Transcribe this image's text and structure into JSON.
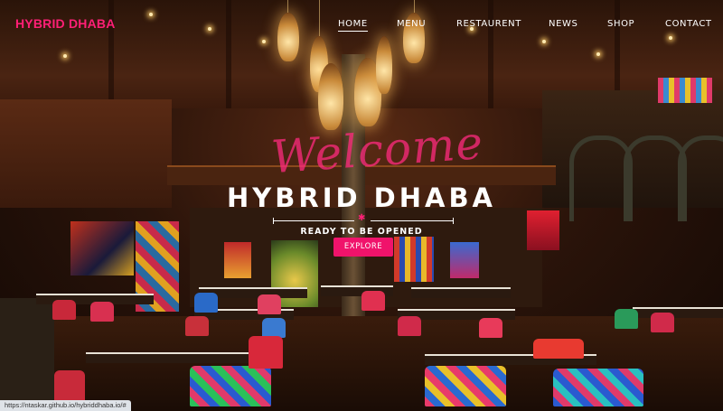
{
  "brand": "HYBRID DHABA",
  "nav": {
    "items": [
      "HOME",
      "MENU",
      "RESTAURENT",
      "NEWS",
      "SHOP",
      "CONTACT"
    ],
    "active": "HOME"
  },
  "hero": {
    "welcome": "Welcome",
    "title": "HYBRID DHABA",
    "tagline": "READY TO BE OPENED",
    "cta": "EXPLORE"
  },
  "status_url": "https://ntaskar.github.io/hybriddhaba.io/#",
  "colors": {
    "accent": "#f0136b",
    "brand": "#ff1f76",
    "text": "#ffffff"
  }
}
